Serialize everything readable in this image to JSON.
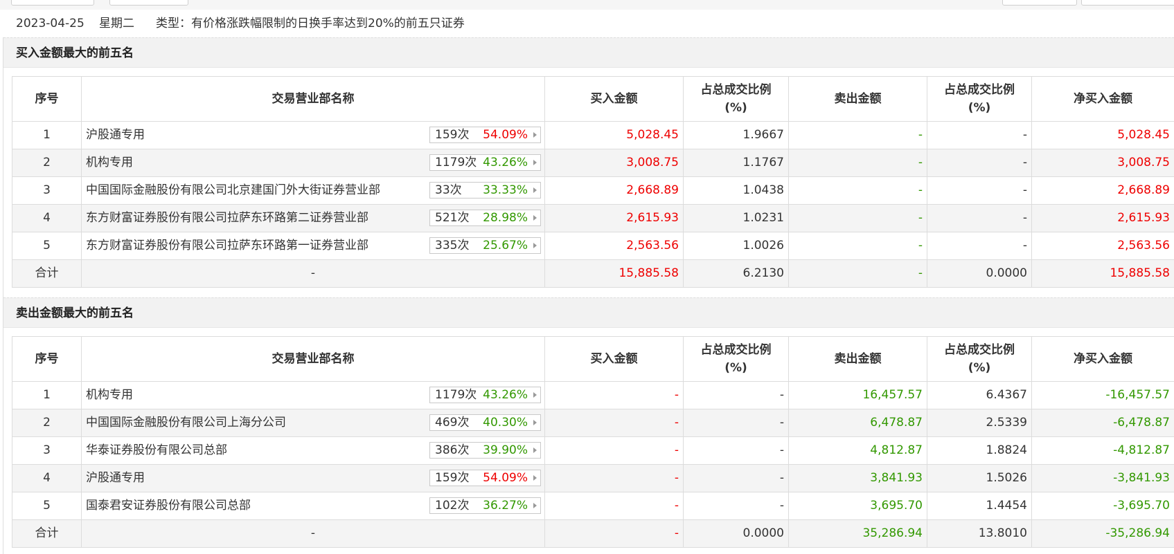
{
  "info": {
    "date": "2023-04-25",
    "weekday": "星期二",
    "type_text": "类型：有价格涨跌幅限制的日换手率达到20%的前五只证券"
  },
  "buy_section": {
    "title": "买入金额最大的前五名",
    "headers": {
      "seq": "序号",
      "name": "交易营业部名称",
      "buy": "买入金额",
      "buy_pct_1": "占总成交比例",
      "buy_pct_2": "(%)",
      "sell": "卖出金额",
      "sell_pct_1": "占总成交比例",
      "sell_pct_2": "(%)",
      "net": "净买入金额"
    },
    "rows": [
      {
        "seq": "1",
        "name": "沪股通专用",
        "count": "159次",
        "pct": "54.09%",
        "pct_color": "#ee0000",
        "buy": "5,028.45",
        "buy_pct": "1.9667",
        "sell": "-",
        "sell_pct": "-",
        "net": "5,028.45"
      },
      {
        "seq": "2",
        "name": "机构专用",
        "count": "1179次",
        "pct": "43.26%",
        "pct_color": "#329800",
        "buy": "3,008.75",
        "buy_pct": "1.1767",
        "sell": "-",
        "sell_pct": "-",
        "net": "3,008.75"
      },
      {
        "seq": "3",
        "name": "中国国际金融股份有限公司北京建国门外大街证券营业部",
        "count": "33次",
        "pct": "33.33%",
        "pct_color": "#329800",
        "buy": "2,668.89",
        "buy_pct": "1.0438",
        "sell": "-",
        "sell_pct": "-",
        "net": "2,668.89"
      },
      {
        "seq": "4",
        "name": "东方财富证券股份有限公司拉萨东环路第二证券营业部",
        "count": "521次",
        "pct": "28.98%",
        "pct_color": "#329800",
        "buy": "2,615.93",
        "buy_pct": "1.0231",
        "sell": "-",
        "sell_pct": "-",
        "net": "2,615.93"
      },
      {
        "seq": "5",
        "name": "东方财富证券股份有限公司拉萨东环路第一证券营业部",
        "count": "335次",
        "pct": "25.67%",
        "pct_color": "#329800",
        "buy": "2,563.56",
        "buy_pct": "1.0026",
        "sell": "-",
        "sell_pct": "-",
        "net": "2,563.56"
      }
    ],
    "total": {
      "label": "合计",
      "name": "-",
      "buy": "15,885.58",
      "buy_pct": "6.2130",
      "sell": "-",
      "sell_pct": "0.0000",
      "net": "15,885.58"
    }
  },
  "sell_section": {
    "title": "卖出金额最大的前五名",
    "headers": {
      "seq": "序号",
      "name": "交易营业部名称",
      "buy": "买入金额",
      "buy_pct_1": "占总成交比例",
      "buy_pct_2": "(%)",
      "sell": "卖出金额",
      "sell_pct_1": "占总成交比例",
      "sell_pct_2": "(%)",
      "net": "净买入金额"
    },
    "rows": [
      {
        "seq": "1",
        "name": "机构专用",
        "count": "1179次",
        "pct": "43.26%",
        "pct_color": "#329800",
        "buy": "-",
        "buy_pct": "-",
        "sell": "16,457.57",
        "sell_pct": "6.4367",
        "net": "-16,457.57"
      },
      {
        "seq": "2",
        "name": "中国国际金融股份有限公司上海分公司",
        "count": "469次",
        "pct": "40.30%",
        "pct_color": "#329800",
        "buy": "-",
        "buy_pct": "-",
        "sell": "6,478.87",
        "sell_pct": "2.5339",
        "net": "-6,478.87"
      },
      {
        "seq": "3",
        "name": "华泰证券股份有限公司总部",
        "count": "386次",
        "pct": "39.90%",
        "pct_color": "#329800",
        "buy": "-",
        "buy_pct": "-",
        "sell": "4,812.87",
        "sell_pct": "1.8824",
        "net": "-4,812.87"
      },
      {
        "seq": "4",
        "name": "沪股通专用",
        "count": "159次",
        "pct": "54.09%",
        "pct_color": "#ee0000",
        "buy": "-",
        "buy_pct": "-",
        "sell": "3,841.93",
        "sell_pct": "1.5026",
        "net": "-3,841.93"
      },
      {
        "seq": "5",
        "name": "国泰君安证券股份有限公司总部",
        "count": "102次",
        "pct": "36.27%",
        "pct_color": "#329800",
        "buy": "-",
        "buy_pct": "-",
        "sell": "3,695.70",
        "sell_pct": "1.4454",
        "net": "-3,695.70"
      }
    ],
    "total": {
      "label": "合计",
      "name": "-",
      "buy": "-",
      "buy_pct": "0.0000",
      "sell": "35,286.94",
      "sell_pct": "13.8010",
      "net": "-35,286.94"
    }
  },
  "colors": {
    "up": "#ee0000",
    "down": "#329800",
    "neutral": "#333333"
  }
}
